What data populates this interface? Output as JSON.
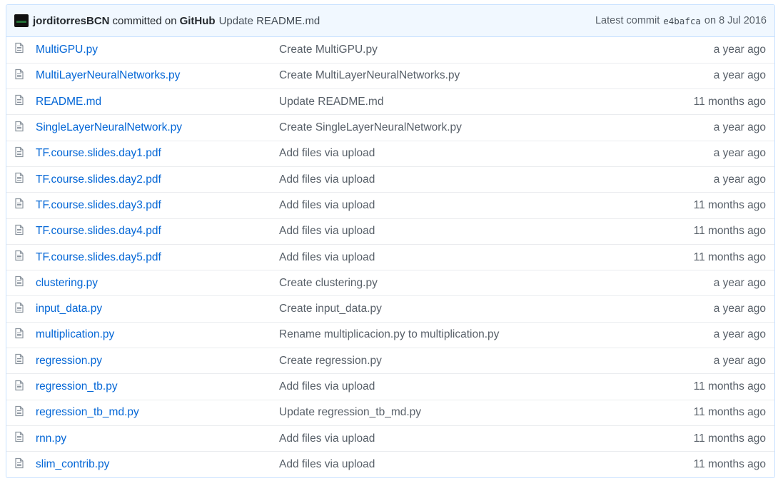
{
  "commit": {
    "author": "jorditorresBCN",
    "committed_text": "committed on",
    "platform": "GitHub",
    "message": "Update README.md",
    "latest_label": "Latest commit",
    "sha": "e4bafca",
    "date_text": "on 8 Jul 2016"
  },
  "files": [
    {
      "name": "MultiGPU.py",
      "message": "Create MultiGPU.py",
      "age": "a year ago"
    },
    {
      "name": "MultiLayerNeuralNetworks.py",
      "message": "Create MultiLayerNeuralNetworks.py",
      "age": "a year ago"
    },
    {
      "name": "README.md",
      "message": "Update README.md",
      "age": "11 months ago"
    },
    {
      "name": "SingleLayerNeuralNetwork.py",
      "message": "Create SingleLayerNeuralNetwork.py",
      "age": "a year ago"
    },
    {
      "name": "TF.course.slides.day1.pdf",
      "message": "Add files via upload",
      "age": "a year ago"
    },
    {
      "name": "TF.course.slides.day2.pdf",
      "message": "Add files via upload",
      "age": "a year ago"
    },
    {
      "name": "TF.course.slides.day3.pdf",
      "message": "Add files via upload",
      "age": "11 months ago"
    },
    {
      "name": "TF.course.slides.day4.pdf",
      "message": "Add files via upload",
      "age": "11 months ago"
    },
    {
      "name": "TF.course.slides.day5.pdf",
      "message": "Add files via upload",
      "age": "11 months ago"
    },
    {
      "name": "clustering.py",
      "message": "Create clustering.py",
      "age": "a year ago"
    },
    {
      "name": "input_data.py",
      "message": "Create input_data.py",
      "age": "a year ago"
    },
    {
      "name": "multiplication.py",
      "message": "Rename multiplicacion.py to multiplication.py",
      "age": "a year ago"
    },
    {
      "name": "regression.py",
      "message": "Create regression.py",
      "age": "a year ago"
    },
    {
      "name": "regression_tb.py",
      "message": "Add files via upload",
      "age": "11 months ago"
    },
    {
      "name": "regression_tb_md.py",
      "message": "Update regression_tb_md.py",
      "age": "11 months ago"
    },
    {
      "name": "rnn.py",
      "message": "Add files via upload",
      "age": "11 months ago"
    },
    {
      "name": "slim_contrib.py",
      "message": "Add files via upload",
      "age": "11 months ago"
    }
  ],
  "icons": {
    "file": "file-icon",
    "avatar": "avatar"
  },
  "colors": {
    "link": "#0366d6",
    "header_bg": "#f1f8ff",
    "border": "#c8e1ff",
    "muted": "#586069"
  }
}
